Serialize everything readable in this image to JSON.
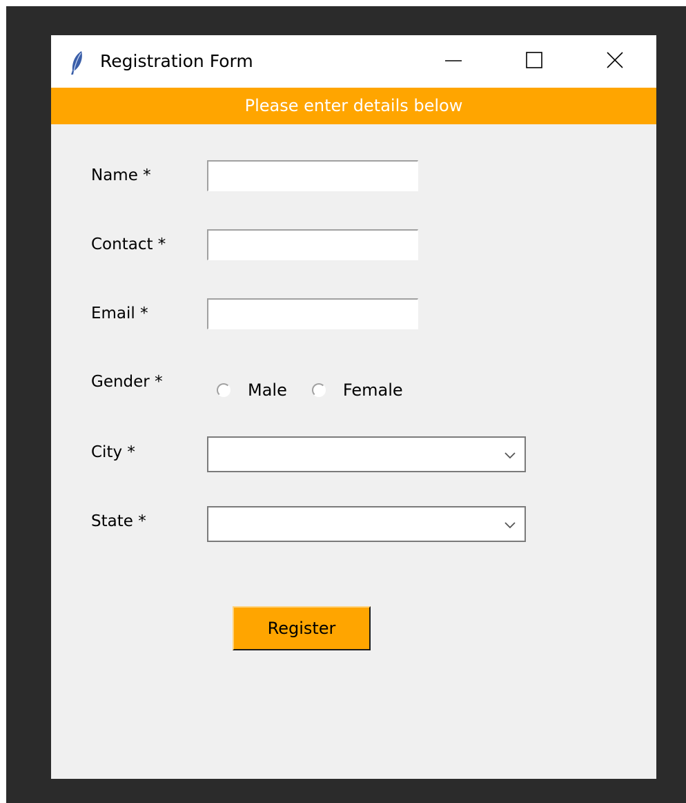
{
  "window": {
    "title": "Registration Form",
    "icon": "feather-icon",
    "controls": [
      "minimize-icon",
      "maximize-icon",
      "close-icon"
    ]
  },
  "banner": {
    "text": "Please enter details below",
    "background": "#ffa500",
    "color": "#ffffff"
  },
  "form": {
    "name_label": "Name *",
    "name_value": "",
    "contact_label": "Contact *",
    "contact_value": "",
    "email_label": "Email *",
    "email_value": "",
    "gender_label": "Gender *",
    "gender_options": [
      "Male",
      "Female"
    ],
    "gender_selected": null,
    "city_label": "City *",
    "city_value": "",
    "state_label": "State *",
    "state_value": "",
    "register_label": "Register"
  },
  "colors": {
    "accent": "#ffa500",
    "window_background": "#f0f0f0",
    "backdrop": "#2b2b2b"
  }
}
